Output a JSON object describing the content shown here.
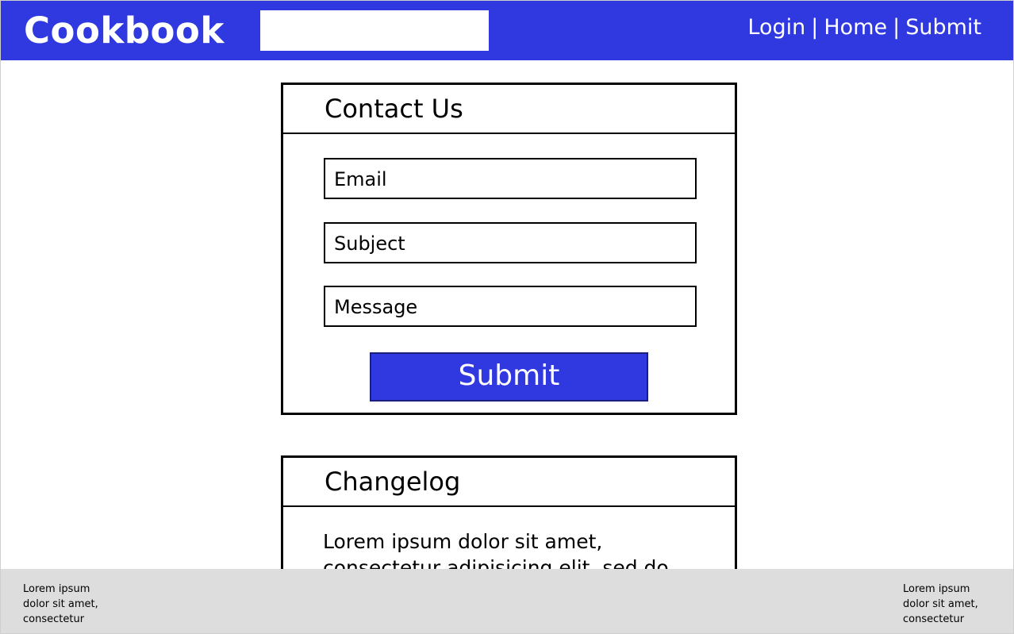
{
  "header": {
    "brand": "Cookbook",
    "search": {
      "value": "",
      "placeholder": ""
    },
    "nav": {
      "login": "Login",
      "home": "Home",
      "submit": "Submit",
      "separator": "|"
    }
  },
  "contact": {
    "title": "Contact Us",
    "email_placeholder": "Email",
    "subject_placeholder": "Subject",
    "message_placeholder": "Message",
    "submit_label": "Submit"
  },
  "changelog": {
    "title": "Changelog",
    "body": "Lorem ipsum dolor sit amet, consectetur adipisicing elit, sed do"
  },
  "footer": {
    "left_text": "Lorem ipsum dolor sit amet, consectetur",
    "right_text": "Lorem ipsum dolor sit amet, consectetur"
  },
  "colors": {
    "brand_blue": "#2f39df",
    "footer_gray": "#dddddd"
  }
}
